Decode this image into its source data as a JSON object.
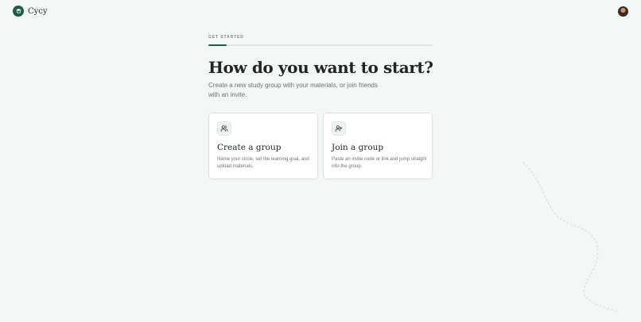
{
  "header": {
    "brand": "Cycy",
    "logo_icon": "graduation-cap-icon",
    "avatar_icon": "user-avatar"
  },
  "onboarding": {
    "step_label": "GET STARTED",
    "progress": 0.08,
    "title": "How do you want to start?",
    "subtitle": "Create a new study group with your materials, or join friends with an invite."
  },
  "options": [
    {
      "icon": "users-icon",
      "title": "Create a group",
      "description": "Name your circle, set the learning goal, and upload materials."
    },
    {
      "icon": "user-plus-icon",
      "title": "Join a group",
      "description": "Paste an invite code or link and jump straight into the group."
    }
  ],
  "colors": {
    "background": "#f4f7f5",
    "accent": "#1f5a48",
    "card": "#ffffff"
  }
}
